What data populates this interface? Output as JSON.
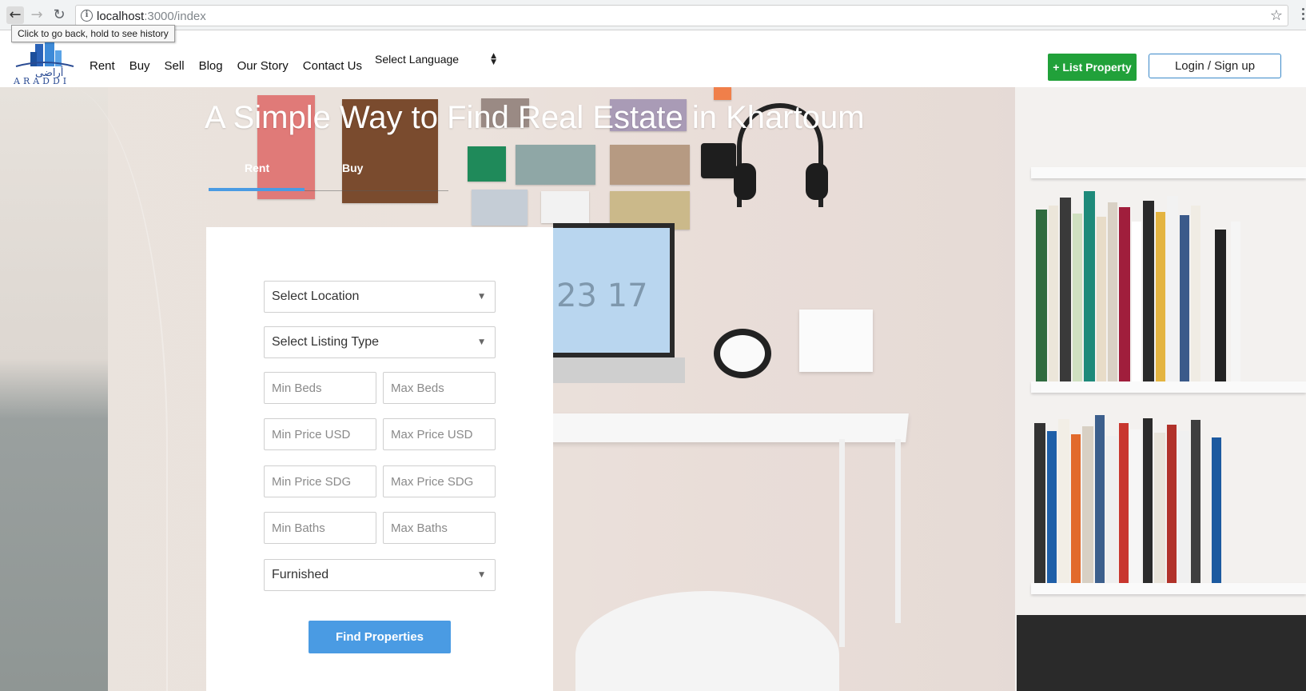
{
  "browser": {
    "url_host": "localhost",
    "url_path": ":3000/index",
    "tooltip": "Click to go back, hold to see history"
  },
  "header": {
    "logo_text": "ARADDI",
    "nav": [
      "Rent",
      "Buy",
      "Sell",
      "Blog",
      "Our Story",
      "Contact Us"
    ],
    "language_select": "Select Language",
    "list_property": "+ List Property",
    "login": "Login / Sign up"
  },
  "hero": {
    "title": "A Simple Way to Find Real Estate in Khartoum",
    "tabs": [
      "Rent",
      "Buy"
    ],
    "active_tab": "Rent",
    "laptop_time": "23 17"
  },
  "form": {
    "location": "Select Location",
    "listing_type": "Select Listing Type",
    "min_beds": "Min Beds",
    "max_beds": "Max Beds",
    "min_price_usd": "Min Price USD",
    "max_price_usd": "Max Price USD",
    "min_price_sdg": "Min Price SDG",
    "max_price_sdg": "Max Price SDG",
    "min_baths": "Min Baths",
    "max_baths": "Max Baths",
    "furnished": "Furnished",
    "submit": "Find Properties"
  },
  "colors": {
    "accent_blue": "#4a9be3",
    "list_green": "#21a13a",
    "login_border": "#3b89c9"
  }
}
